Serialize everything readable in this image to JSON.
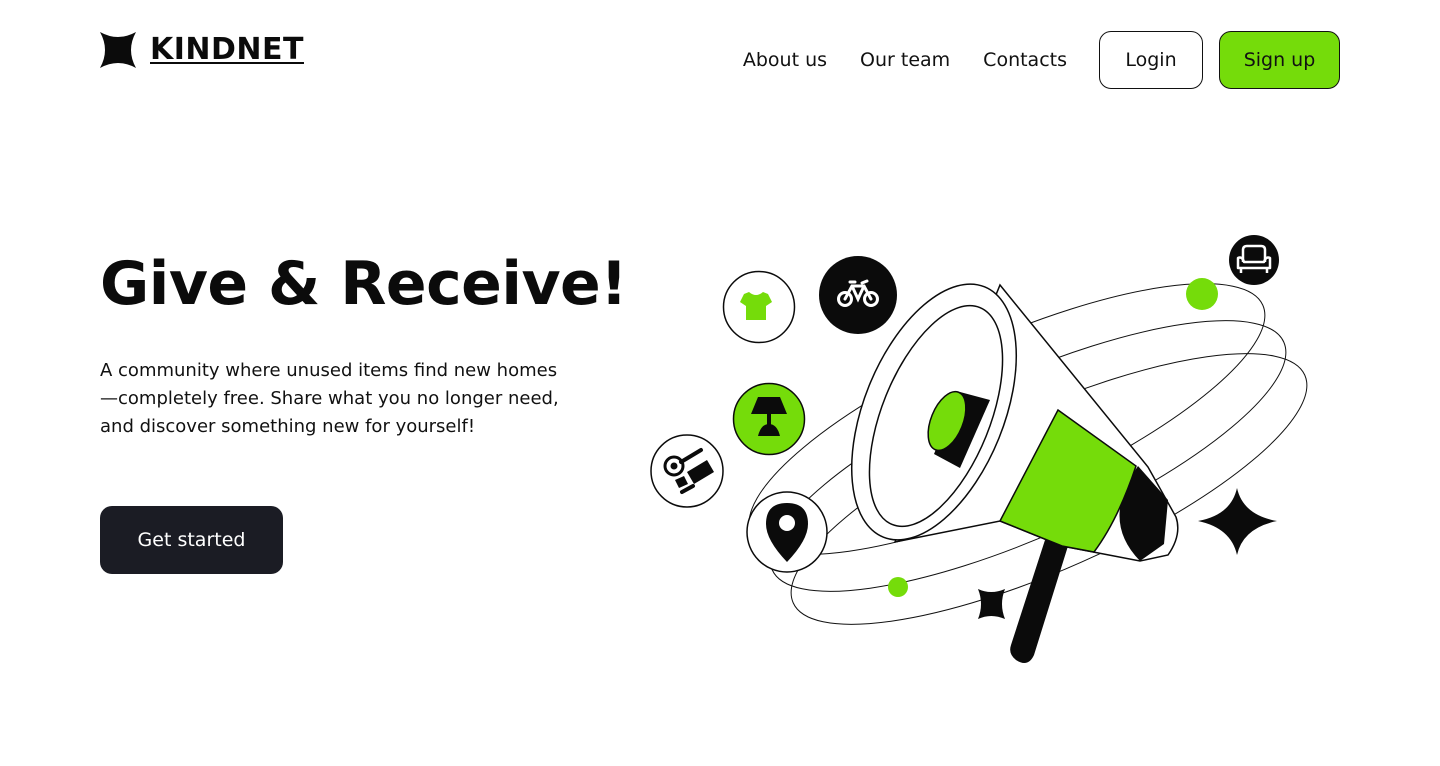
{
  "brand": {
    "name": "KINDNET",
    "logo_icon": "four-point-star-logo"
  },
  "nav": {
    "links": [
      {
        "label": "About us"
      },
      {
        "label": "Our team"
      },
      {
        "label": "Contacts"
      }
    ],
    "login_label": "Login",
    "signup_label": "Sign up"
  },
  "hero": {
    "title": "Give & Receive!",
    "description": "A community where unused items find new homes—completely free. Share what you no longer need, and discover something new for yourself!",
    "cta_label": "Get started"
  },
  "illustration": {
    "icons": [
      "shirt-icon",
      "bicycle-icon",
      "lamp-icon",
      "kitchenware-icon",
      "location-pin-icon",
      "armchair-icon",
      "megaphone-icon",
      "sparkle-icon"
    ]
  },
  "colors": {
    "accent": "#75dc0a",
    "dark": "#1b1c24",
    "text": "#0b0b0b",
    "background": "#ffffff"
  }
}
